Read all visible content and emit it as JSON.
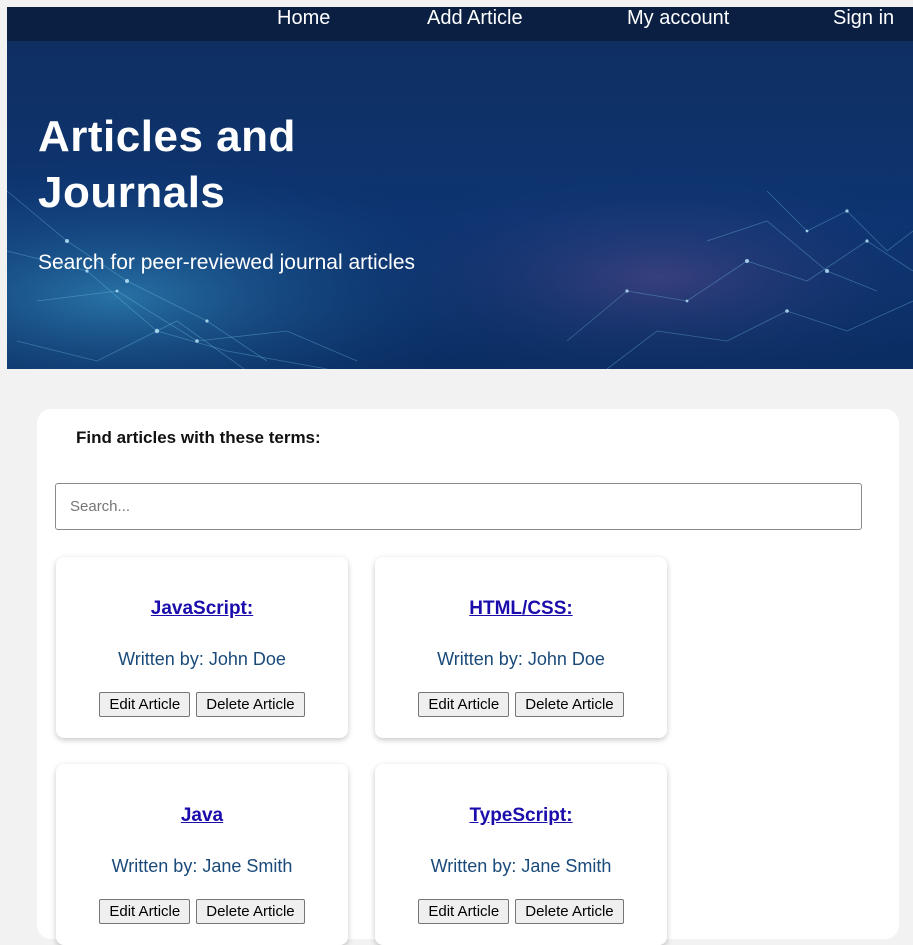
{
  "nav": {
    "items": [
      {
        "label": "Home"
      },
      {
        "label": "Add Article"
      },
      {
        "label": "My account"
      },
      {
        "label": "Sign in"
      }
    ]
  },
  "hero": {
    "title": "Articles and Journals",
    "subtitle": "Search for peer-reviewed journal articles"
  },
  "search": {
    "label": "Find articles with these terms:",
    "placeholder": "Search...",
    "value": ""
  },
  "articles": [
    {
      "title": "JavaScript:",
      "author": "Written by: John Doe",
      "edit_label": "Edit Article",
      "delete_label": "Delete Article"
    },
    {
      "title": "HTML/CSS:",
      "author": "Written by: John Doe",
      "edit_label": "Edit Article",
      "delete_label": "Delete Article"
    },
    {
      "title": "Java",
      "author": "Written by: Jane Smith",
      "edit_label": "Edit Article",
      "delete_label": "Delete Article"
    },
    {
      "title": "TypeScript:",
      "author": "Written by: Jane Smith",
      "edit_label": "Edit Article",
      "delete_label": "Delete Article"
    }
  ],
  "colors": {
    "nav_bg": "#0a1f42",
    "hero_bg": "#0d3471",
    "link": "#1a0dab",
    "author_text": "#1a4a7a",
    "page_bg": "#f2f2f2"
  }
}
